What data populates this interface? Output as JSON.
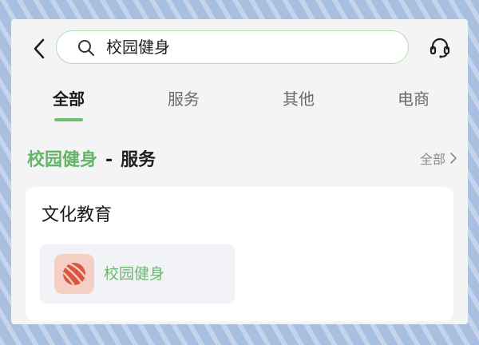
{
  "search": {
    "query": "校园健身"
  },
  "tabs": [
    {
      "label": "全部",
      "active": true
    },
    {
      "label": "服务",
      "active": false
    },
    {
      "label": "其他",
      "active": false
    },
    {
      "label": "电商",
      "active": false
    }
  ],
  "section": {
    "keyword": "校园健身",
    "separator": "-",
    "category": "服务",
    "see_all": "全部"
  },
  "card": {
    "title": "文化教育",
    "results": [
      {
        "label": "校园健身",
        "icon": "basketball-icon"
      }
    ]
  },
  "icons": {
    "back": "chevron-left-icon",
    "search": "search-icon",
    "support": "headset-icon",
    "see_all": "chevron-right-icon"
  },
  "colors": {
    "accent": "#6fbf73",
    "highlight_text": "#66b46a",
    "app_icon_bg": "#f5cfc6",
    "app_icon_ball": "#d9573f"
  }
}
